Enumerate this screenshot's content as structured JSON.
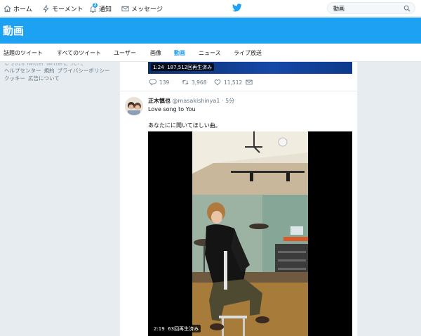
{
  "topnav": {
    "home": "ホーム",
    "moments": "モーメント",
    "notifications": "通知",
    "notification_count": "2",
    "messages": "メッセージ",
    "search_value": "動画"
  },
  "header": {
    "title": "動画"
  },
  "tabs": [
    {
      "label": "話題のツイート",
      "active": false
    },
    {
      "label": "すべてのツイート",
      "active": false
    },
    {
      "label": "ユーザー",
      "active": false
    },
    {
      "label": "画像",
      "active": false
    },
    {
      "label": "動画",
      "active": true
    },
    {
      "label": "ニュース",
      "active": false
    },
    {
      "label": "ライブ放送",
      "active": false
    }
  ],
  "footer": {
    "faded_line": "© 2018 Twitter  Twitterについて",
    "links": [
      "ヘルプセンター",
      "規約",
      "プライバシーポリシー",
      "クッキー",
      "広告について"
    ]
  },
  "prev_tweet": {
    "duration": "1:24",
    "views": "187,512回再生済み",
    "replies": "139",
    "retweets": "3,968",
    "likes": "11,512"
  },
  "tweet": {
    "name": "正木慎也",
    "handle": "@masakishinya1",
    "time": "5分",
    "text_line1": "Love song to You",
    "text_line2": "あなたにに聞いてほしい曲。",
    "duration": "2:19",
    "views": "63回再生済み"
  },
  "colors": {
    "brand": "#1da1f2",
    "background": "#e6ecf0",
    "text": "#14171a",
    "muted": "#657786"
  }
}
